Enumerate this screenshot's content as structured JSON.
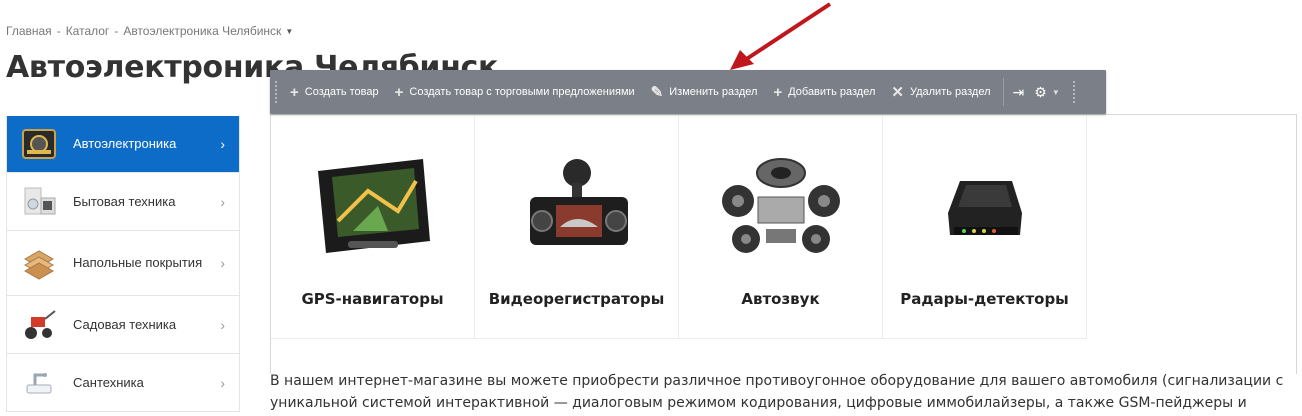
{
  "breadcrumb": {
    "items": [
      "Главная",
      "Каталог",
      "Автоэлектроника Челябинск"
    ],
    "separator": "-"
  },
  "page_title": "Автоэлектроника Челябинск",
  "toolbar": {
    "create_product": "Создать товар",
    "create_product_offers": "Создать товар с торговыми предложениями",
    "edit_section": "Изменить раздел",
    "add_section": "Добавить раздел",
    "delete_section": "Удалить раздел"
  },
  "sidebar": {
    "items": [
      {
        "label": "Автоэлектроника",
        "icon": "car-stereo-icon",
        "active": true
      },
      {
        "label": "Бытовая техника",
        "icon": "appliances-icon",
        "active": false
      },
      {
        "label": "Напольные покрытия",
        "icon": "flooring-icon",
        "active": false
      },
      {
        "label": "Садовая техника",
        "icon": "garden-tiller-icon",
        "active": false
      },
      {
        "label": "Сантехника",
        "icon": "plumbing-icon",
        "active": false
      }
    ]
  },
  "categories": [
    {
      "name": "GPS-навигаторы",
      "icon": "gps-navigator-image"
    },
    {
      "name": "Видеорегистраторы",
      "icon": "dashcam-image"
    },
    {
      "name": "Автозвук",
      "icon": "car-audio-image"
    },
    {
      "name": "Радары-детекторы",
      "icon": "radar-detector-image"
    }
  ],
  "description": "В нашем интернет-магазине вы можете приобрести различное противоугонное оборудование для вашего автомобиля (сигнализации с уникальной системой интерактивной — диалоговым режимом кодирования, цифровые иммобилайзеры, а также GSM-пейджеры и другие устройства).",
  "colors": {
    "active_bg": "#0d6cc8",
    "toolbar_bg": "#7a7f88",
    "arrow": "#c0171d"
  }
}
